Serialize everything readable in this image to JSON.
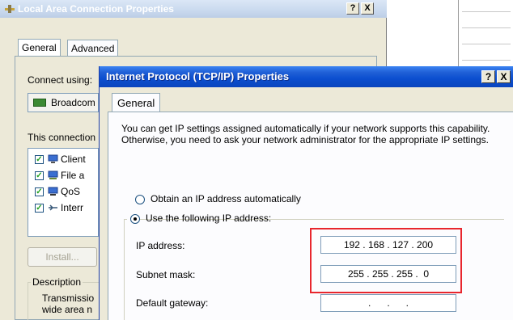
{
  "background_window": {
    "title": "Local Area Connection Properties",
    "help_button": "?",
    "close_button": "X",
    "tabs": [
      {
        "label": "General"
      },
      {
        "label": "Advanced"
      }
    ],
    "connect_using_label": "Connect using:",
    "adapter_name": "Broadcom",
    "this_connection_label": "This connection uses the following items:",
    "items": [
      {
        "label": "Client",
        "checked": true,
        "icon": "network-client-icon"
      },
      {
        "label": "File a",
        "checked": true,
        "icon": "file-sharing-icon"
      },
      {
        "label": "QoS",
        "checked": true,
        "icon": "qos-icon"
      },
      {
        "label": "Interr",
        "checked": true,
        "icon": "protocol-icon"
      }
    ],
    "install_button": "Install...",
    "description_legend": "Description",
    "description_text_line1": "Transmissio",
    "description_text_line2": "wide area n"
  },
  "dialog": {
    "title": "Internet Protocol (TCP/IP) Properties",
    "help_button": "?",
    "close_button": "X",
    "tabs": [
      {
        "label": "General"
      }
    ],
    "intro_text": "You can get IP settings assigned automatically if your network supports this capability. Otherwise, you need to ask your network administrator for the appropriate IP settings.",
    "radio_auto_label": "Obtain an IP address automatically",
    "radio_manual_label": "Use the following IP address:",
    "selected_option": "manual",
    "fields": {
      "ip_address_label": "IP address:",
      "ip_address_value": "192 . 168 . 127 . 200",
      "subnet_mask_label": "Subnet mask:",
      "subnet_mask_value": "255 . 255 . 255 .  0",
      "default_gateway_label": "Default gateway:",
      "default_gateway_value": "    .      .      .    "
    }
  },
  "colors": {
    "highlight": "#e8262d",
    "dialog_titlebar": "#0b4ecf",
    "window_face": "#ece9d8"
  }
}
